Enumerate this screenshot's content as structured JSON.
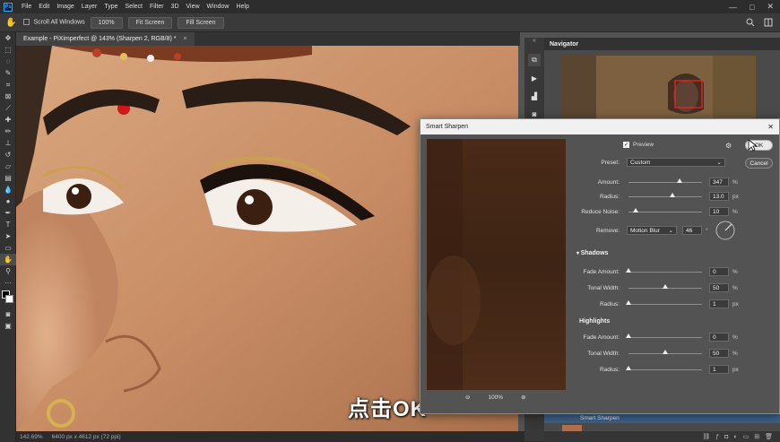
{
  "menubar": {
    "logo": "Ps",
    "items": [
      "File",
      "Edit",
      "Image",
      "Layer",
      "Type",
      "Select",
      "Filter",
      "3D",
      "View",
      "Window",
      "Help"
    ],
    "window_controls": {
      "minimize": "—",
      "maximize": "□",
      "close": "✕"
    }
  },
  "options": {
    "scroll_all_windows": "Scroll All Windows",
    "zoom_100": "100%",
    "fit_screen": "Fit Screen",
    "fill_screen": "Fill Screen"
  },
  "document": {
    "tab_title": "Example - PiXimperfect @ 143% (Sharpen 2, RGB/8) *",
    "close": "×"
  },
  "status": {
    "zoom": "142.69%",
    "dimensions": "6400 px x 4612 px (72 ppi)"
  },
  "subtitle": "点击OK",
  "navigator": {
    "title": "Navigator",
    "layer_name": "Smart Sharpen"
  },
  "dialog": {
    "title": "Smart Sharpen",
    "close": "✕",
    "preview_label": "Preview",
    "preview_checked": true,
    "preset_label": "Preset:",
    "preset_value": "Custom",
    "amount_label": "Amount:",
    "amount_value": "347",
    "amount_unit": "%",
    "amount_fraction": 0.69,
    "radius_label": "Radius:",
    "radius_value": "13.0",
    "radius_unit": "px",
    "radius_fraction": 0.6,
    "reduce_noise_label": "Reduce Noise:",
    "reduce_noise_value": "10",
    "reduce_noise_unit": "%",
    "reduce_noise_fraction": 0.1,
    "remove_label": "Remove:",
    "remove_value": "Motion Blur",
    "remove_angle": "46",
    "remove_angle_unit": "°",
    "shadows_title": "Shadows",
    "highlights_title": "Highlights",
    "shadows": {
      "fade_label": "Fade Amount:",
      "fade_value": "0",
      "fade_unit": "%",
      "fade_fraction": 0.0,
      "tonal_label": "Tonal Width:",
      "tonal_value": "50",
      "tonal_unit": "%",
      "tonal_fraction": 0.5,
      "radius_label": "Radius:",
      "radius_value": "1",
      "radius_unit": "px",
      "radius_fraction": 0.0
    },
    "highlights": {
      "fade_label": "Fade Amount:",
      "fade_value": "0",
      "fade_unit": "%",
      "fade_fraction": 0.0,
      "tonal_label": "Tonal Width:",
      "tonal_value": "50",
      "tonal_unit": "%",
      "tonal_fraction": 0.5,
      "radius_label": "Radius:",
      "radius_value": "1",
      "radius_unit": "px",
      "radius_fraction": 0.0
    },
    "preview_zoom": "100%",
    "ok_label": "OK",
    "cancel_label": "Cancel"
  }
}
